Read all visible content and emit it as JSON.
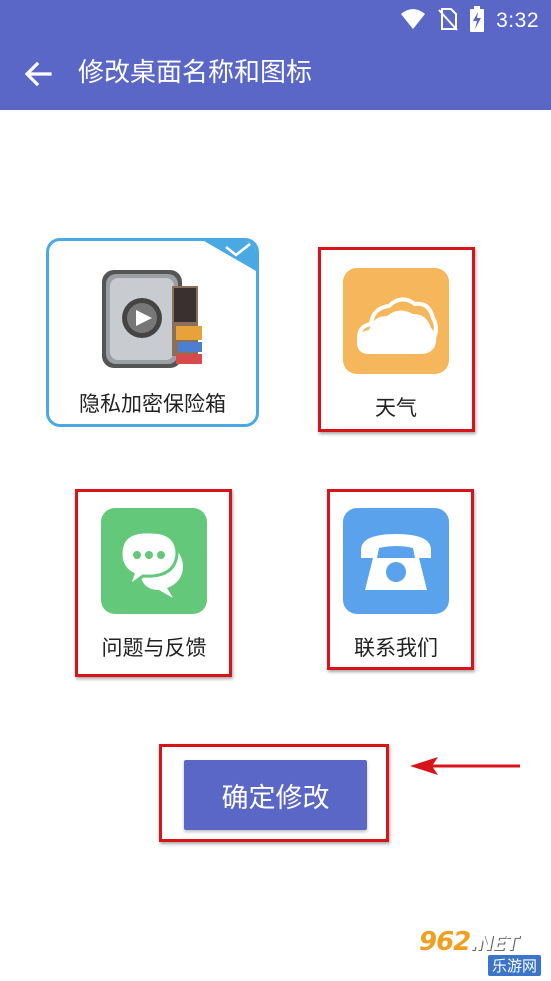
{
  "status_bar": {
    "time": "3:32",
    "icons": [
      "wifi-icon",
      "no-sim-icon",
      "battery-charging-icon"
    ],
    "background": "#5b67c7"
  },
  "app_bar": {
    "title": "修改桌面名称和图标",
    "back_icon": "arrow-left-icon"
  },
  "options": [
    {
      "label": "隐私加密保险箱",
      "icon": "safe-vault-icon",
      "selected": true
    },
    {
      "label": "天气",
      "icon": "cloud-icon",
      "icon_color": "#f6b65c",
      "selected": false
    },
    {
      "label": "问题与反馈",
      "icon": "chat-bubbles-icon",
      "icon_color": "#63c87a",
      "selected": false
    },
    {
      "label": "联系我们",
      "icon": "telephone-icon",
      "icon_color": "#5aa3ec",
      "selected": false
    }
  ],
  "selected_check_icon": "checkmark-icon",
  "confirm_button": {
    "label": "确定修改"
  },
  "annotations": {
    "highlight_color": "#d8141a",
    "arrow_icon": "arrow-left-icon"
  },
  "watermark": {
    "top": "962",
    "net": ".NET",
    "bottom": "乐游网"
  },
  "colors": {
    "accent": "#5b67c7",
    "selected_border": "#4aa8e3"
  }
}
